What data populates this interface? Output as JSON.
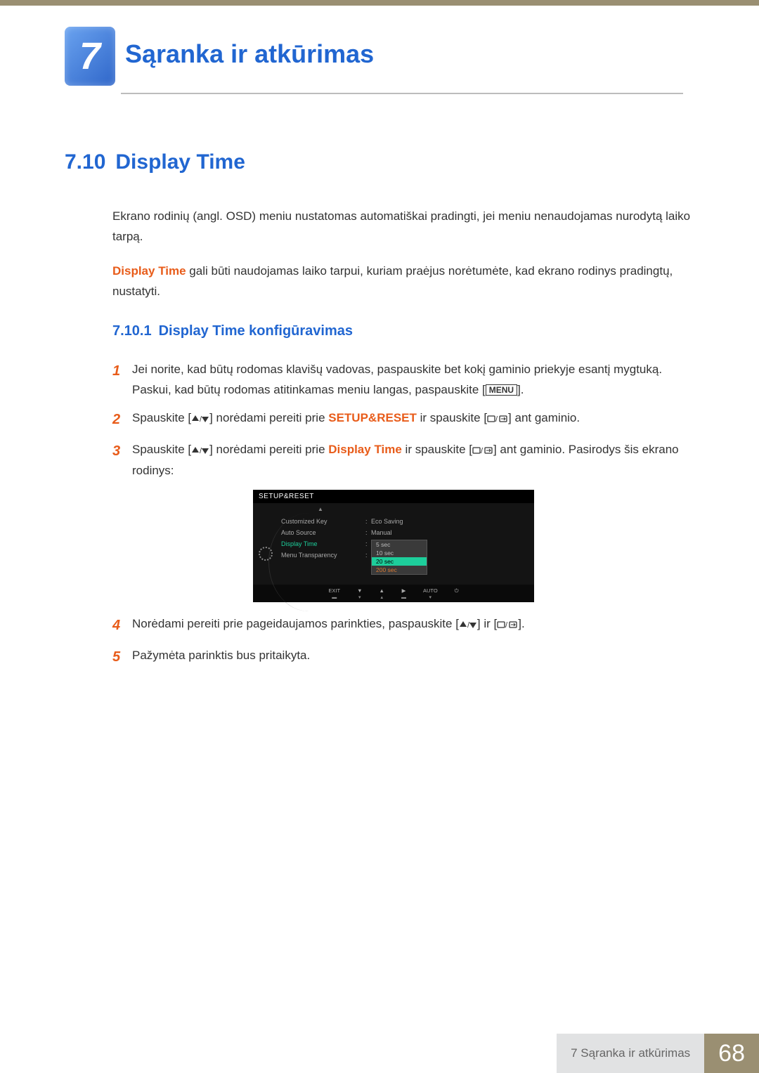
{
  "chapter": {
    "number": "7",
    "title": "Sąranka ir atkūrimas"
  },
  "section": {
    "number": "7.10",
    "title": "Display Time",
    "intro1": "Ekrano rodinių (angl. OSD) meniu nustatomas automatiškai pradingti, jei meniu nenaudojamas nurodytą laiko tarpą.",
    "intro2_em": "Display Time",
    "intro2_rest": " gali būti naudojamas laiko tarpui, kuriam praėjus norėtumėte, kad ekrano rodinys pradingtų, nustatyti."
  },
  "subsection": {
    "number": "7.10.1",
    "title": "Display Time konfigūravimas"
  },
  "steps": [
    {
      "n": "1",
      "text_a": "Jei norite, kad būtų rodomas klavišų vadovas, paspauskite bet kokį gaminio priekyje esantį mygtuką. Paskui, kad būtų rodomas atitinkamas meniu langas, paspauskite [",
      "menu": "MENU",
      "text_b": "]."
    },
    {
      "n": "2",
      "pre": "Spauskite [",
      "mid": "] norėdami pereiti prie ",
      "em": "SETUP&RESET",
      "post": " ir spauskite [",
      "tail": "] ant gaminio."
    },
    {
      "n": "3",
      "pre": "Spauskite [",
      "mid": "] norėdami pereiti prie ",
      "em": "Display Time",
      "post": " ir spauskite [",
      "tail": "] ant gaminio. Pasirodys šis ekrano rodinys:"
    },
    {
      "n": "4",
      "pre": "Norėdami pereiti prie pageidaujamos parinkties, paspauskite [",
      "mid": "] ir [",
      "tail": "]."
    },
    {
      "n": "5",
      "text": "Pažymėta parinktis bus pritaikyta."
    }
  ],
  "osd": {
    "title": "SETUP&RESET",
    "rows": [
      {
        "label": "Customized Key",
        "value": "Eco Saving"
      },
      {
        "label": "Auto Source",
        "value": "Manual"
      },
      {
        "label": "Display Time",
        "value": ""
      },
      {
        "label": "Menu Transparency",
        "value": ""
      }
    ],
    "options": [
      "5 sec",
      "10 sec",
      "20 sec",
      "200 sec"
    ],
    "footer": [
      "EXIT",
      "▼",
      "▲",
      "▶",
      "AUTO",
      "⏻"
    ]
  },
  "footer": {
    "label": "7 Sąranka ir atkūrimas",
    "page": "68"
  }
}
